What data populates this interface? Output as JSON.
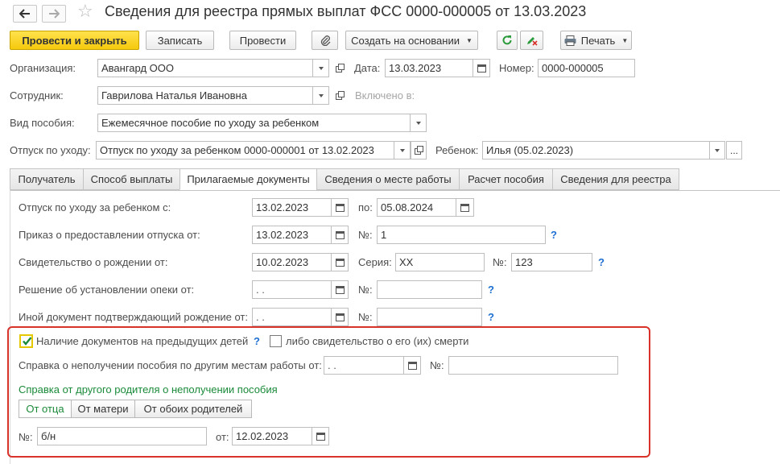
{
  "window": {
    "title": "Сведения для реестра прямых выплат ФСС 0000-000005 от 13.03.2023"
  },
  "toolbar": {
    "post_close": "Провести и закрыть",
    "write": "Записать",
    "post": "Провести",
    "create_based": "Создать на основании",
    "print": "Печать"
  },
  "header": {
    "org_label": "Организация:",
    "org_value": "Авангард ООО",
    "date_label": "Дата:",
    "date_value": "13.03.2023",
    "number_label": "Номер:",
    "number_value": "0000-000005",
    "employee_label": "Сотрудник:",
    "employee_value": "Гаврилова Наталья Ивановна",
    "included_label": "Включено в:",
    "benefit_label": "Вид пособия:",
    "benefit_value": "Ежемесячное пособие по уходу за ребенком",
    "leave_label": "Отпуск по уходу:",
    "leave_value": "Отпуск по уходу за ребенком 0000-000001 от 13.02.2023",
    "child_label": "Ребенок:",
    "child_value": "Илья (05.02.2023)",
    "ellipsis": "..."
  },
  "tabs": [
    {
      "label": "Получатель"
    },
    {
      "label": "Способ выплаты"
    },
    {
      "label": "Прилагаемые документы"
    },
    {
      "label": "Сведения о месте работы"
    },
    {
      "label": "Расчет пособия"
    },
    {
      "label": "Сведения для реестра"
    }
  ],
  "docs": {
    "leave_from_label": "Отпуск по уходу за ребенком с:",
    "leave_from_value": "13.02.2023",
    "to_label": "по:",
    "leave_to_value": "05.08.2024",
    "order_label": "Приказ о предоставлении отпуска от:",
    "order_date": "13.02.2023",
    "num_label": "№:",
    "order_num": "1",
    "birth_label": "Свидетельство о рождении от:",
    "birth_date": "10.02.2023",
    "series_label": "Серия:",
    "birth_series": "XX",
    "birth_num": "123",
    "custody_label": "Решение об установлении опеки от:",
    "custody_date": " .  .",
    "other_label": "Иной документ подтверждающий рождение от:",
    "other_date": " .  .",
    "help": "?"
  },
  "highlight": {
    "prev_children_label": "Наличие документов на предыдущих детей",
    "prev_children_checked": true,
    "death_cert_label": "либо свидетельство о его (их) смерти",
    "death_cert_checked": false,
    "no_benefit_label": "Справка о неполучении пособия по другим местам работы от:",
    "no_benefit_date": " .  .",
    "other_parent_label": "Справка от другого родителя о неполучении пособия",
    "segments": [
      "От отца",
      "От матери",
      "От обоих родителей"
    ],
    "ref_num": "б/н",
    "from_label": "от:",
    "ref_date": "12.02.2023"
  },
  "colors": {
    "accent_yellow": "#f5c90c",
    "highlight_red": "#d9322b",
    "link_blue": "#1e6fd1",
    "active_green": "#1a8a3a"
  }
}
